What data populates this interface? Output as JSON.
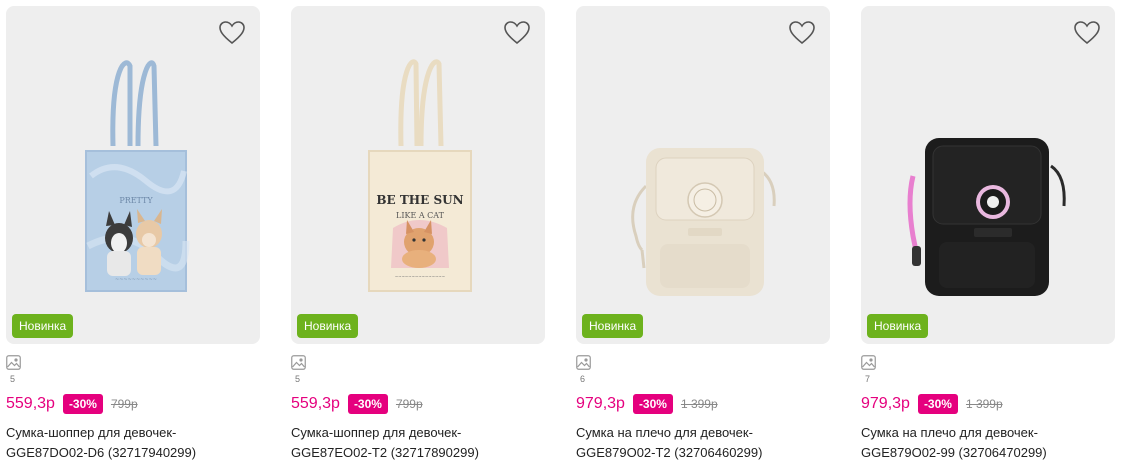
{
  "products": [
    {
      "badge": "Новинка",
      "photo_count": "5",
      "price": "559,3р",
      "discount": "-30%",
      "old_price": "799р",
      "title_line1": "Сумка-шоппер для девочек-",
      "title_line2": "GGE87DO02-D6 (32717940299)",
      "image_icon": "denim-tote-bag-with-dogs"
    },
    {
      "badge": "Новинка",
      "photo_count": "5",
      "price": "559,3р",
      "discount": "-30%",
      "old_price": "799р",
      "title_line1": "Сумка-шоппер для девочек-",
      "title_line2": "GGE87EO02-T2 (32717890299)",
      "image_icon": "cream-tote-bag-with-kitten"
    },
    {
      "badge": "Новинка",
      "photo_count": "6",
      "price": "979,3р",
      "discount": "-30%",
      "old_price": "1 399р",
      "title_line1": "Сумка на плечо для девочек-",
      "title_line2": "GGE879O02-T2 (32706460299)",
      "image_icon": "cream-crossbody-bag"
    },
    {
      "badge": "Новинка",
      "photo_count": "7",
      "price": "979,3р",
      "discount": "-30%",
      "old_price": "1 399р",
      "title_line1": "Сумка на плечо для девочек-",
      "title_line2": "GGE879O02-99 (32706470299)",
      "image_icon": "black-crossbody-bag"
    }
  ],
  "colors": {
    "price": "#e5007e",
    "badge": "#6db21d",
    "card_bg": "#eeeeee"
  }
}
